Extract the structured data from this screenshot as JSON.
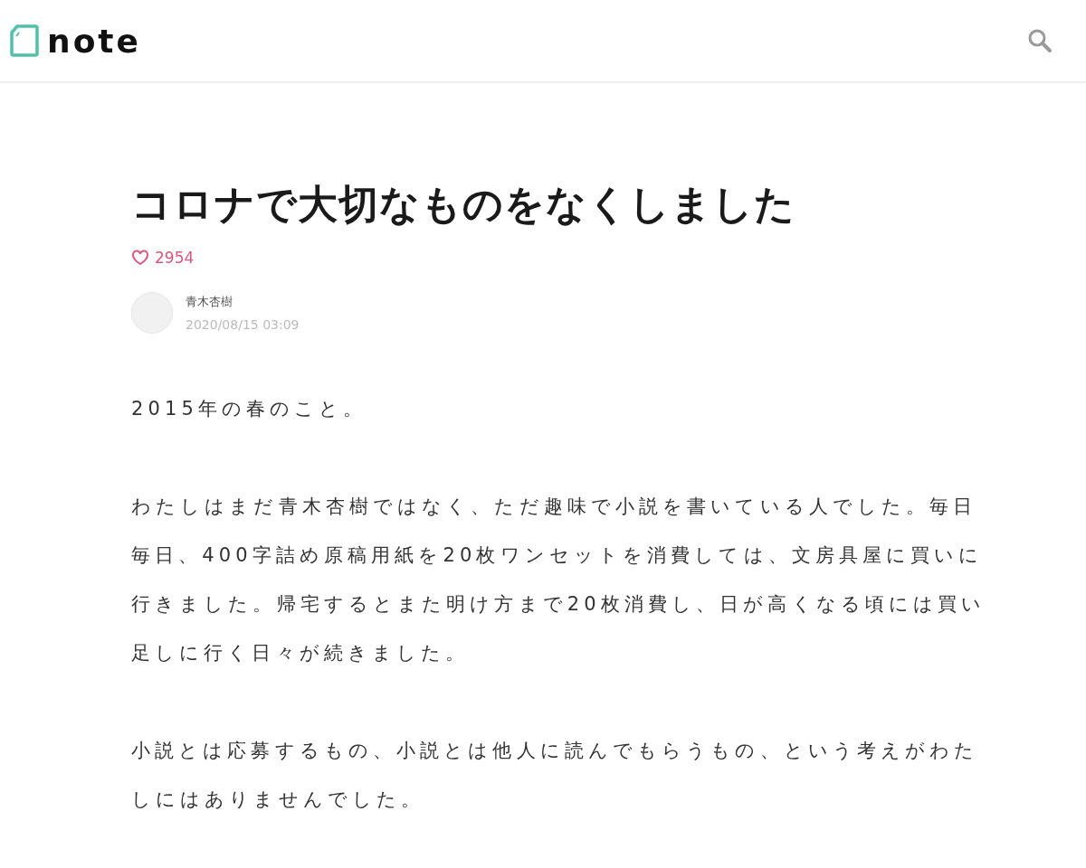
{
  "header": {
    "logo": "note"
  },
  "article": {
    "title": "コロナで大切なものをなくしました",
    "likes": "2954",
    "author": {
      "name": "青木杏樹",
      "date": "2020/08/15 03:09"
    },
    "paragraphs": [
      "2015年の春のこと。",
      "わたしはまだ青木杏樹ではなく、ただ趣味で小説を書いている人でした。毎日毎日、400字詰め原稿用紙を20枚ワンセットを消費しては、文房具屋に買いに行きました。帰宅するとまた明け方まで20枚消費し、日が高くなる頃には買い足しに行く日々が続きました。",
      "小説とは応募するもの、小説とは他人に読んでもらうもの、という考えがわたしにはありませんでした。"
    ]
  }
}
